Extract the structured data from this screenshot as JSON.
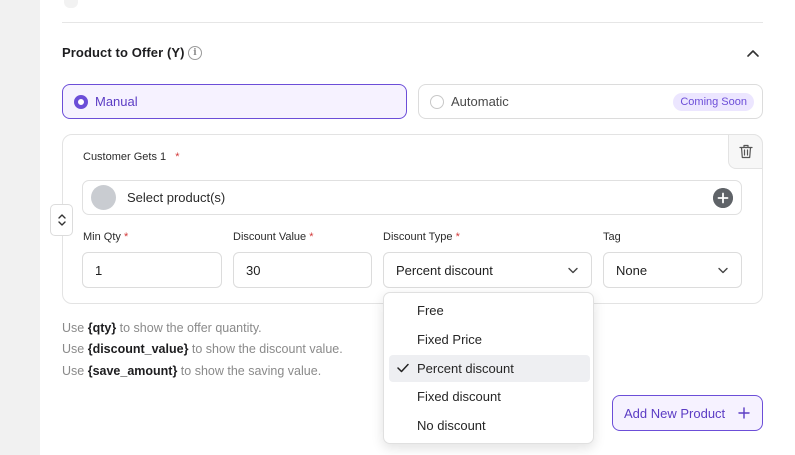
{
  "section": {
    "title": "Product to Offer (Y)"
  },
  "mode": {
    "manual_label": "Manual",
    "automatic_label": "Automatic",
    "coming_soon_badge": "Coming Soon",
    "selected": "Manual",
    "accent_color": "#6c4ed8"
  },
  "card": {
    "label": "Customer Gets 1",
    "required_mark": "*",
    "product_placeholder": "Select product(s)",
    "fields": {
      "min_qty": {
        "label": "Min Qty",
        "required": "*",
        "value": "1"
      },
      "discount_value": {
        "label": "Discount Value",
        "required": "*",
        "value": "30"
      },
      "discount_type": {
        "label": "Discount Type",
        "required": "*",
        "value": "Percent discount"
      },
      "tag": {
        "label": "Tag",
        "value": "None"
      }
    }
  },
  "discount_type_options": [
    {
      "label": "Free",
      "selected": false
    },
    {
      "label": "Fixed Price",
      "selected": false
    },
    {
      "label": "Percent discount",
      "selected": true
    },
    {
      "label": "Fixed discount",
      "selected": false
    },
    {
      "label": "No discount",
      "selected": false
    }
  ],
  "help": [
    {
      "prefix": "Use ",
      "code": "{qty}",
      "suffix": " to show the offer quantity."
    },
    {
      "prefix": "Use ",
      "code": "{discount_value}",
      "suffix": " to show the discount value."
    },
    {
      "prefix": "Use ",
      "code": "{save_amount}",
      "suffix": " to show the saving value."
    }
  ],
  "actions": {
    "add_product_label": "Add New Product"
  },
  "icons": {
    "info": "info-icon",
    "collapse": "chevron-up-icon",
    "delete": "trash-icon",
    "reorder": "up-down-chevron-icon",
    "add_product": "plus-circle-icon",
    "dropdown": "chevron-down-icon",
    "check": "check-icon",
    "add": "plus-icon"
  }
}
